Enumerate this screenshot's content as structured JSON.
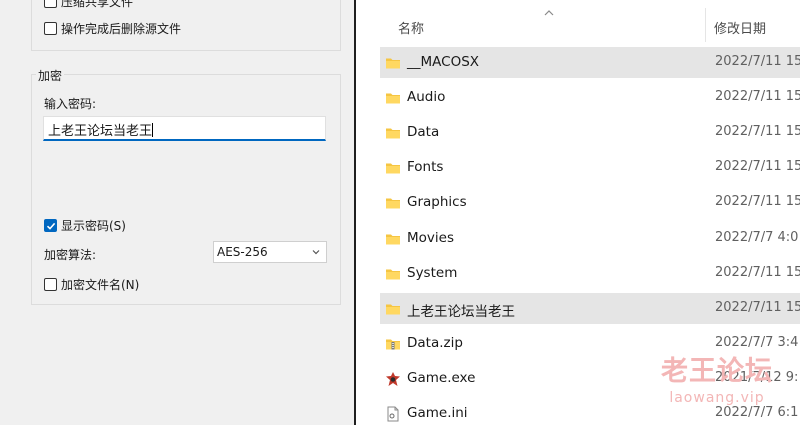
{
  "options": {
    "compress_shared_label": "压缩共享文件",
    "delete_source_label": "操作完成后删除源文件"
  },
  "encryption": {
    "group_title": "加密",
    "password_label": "输入密码:",
    "password_value": "上老王论坛当老王",
    "show_password_label": "显示密码(S)",
    "show_password_checked": true,
    "method_label": "加密算法:",
    "method_value": "AES-256",
    "encrypt_names_label": "加密文件名(N)",
    "encrypt_names_checked": false
  },
  "explorer": {
    "columns": {
      "name": "名称",
      "date": "修改日期"
    },
    "files": [
      {
        "name": "__MACOSX",
        "date": "2022/7/11 15",
        "icon": "folder-icon",
        "selected": true
      },
      {
        "name": "Audio",
        "date": "2022/7/11 15",
        "icon": "folder-icon",
        "selected": false
      },
      {
        "name": "Data",
        "date": "2022/7/11 15",
        "icon": "folder-icon",
        "selected": false
      },
      {
        "name": "Fonts",
        "date": "2022/7/11 15",
        "icon": "folder-icon",
        "selected": false
      },
      {
        "name": "Graphics",
        "date": "2022/7/11 15",
        "icon": "folder-icon",
        "selected": false
      },
      {
        "name": "Movies",
        "date": "2022/7/7 4:0",
        "icon": "folder-icon",
        "selected": false
      },
      {
        "name": "System",
        "date": "2022/7/11 15",
        "icon": "folder-icon",
        "selected": false
      },
      {
        "name": "上老王论坛当老王",
        "date": "2022/7/11 15",
        "icon": "folder-icon",
        "selected": true
      },
      {
        "name": "Data.zip",
        "date": "2022/7/7 3:4",
        "icon": "zip-folder-icon",
        "selected": false
      },
      {
        "name": "Game.exe",
        "date": "2021/7/12 9:",
        "icon": "game-exe-icon",
        "selected": false
      },
      {
        "name": "Game.ini",
        "date": "2022/7/7 6:1",
        "icon": "ini-file-icon",
        "selected": false
      }
    ]
  },
  "watermark": {
    "main": "老王论坛",
    "sub": "laowang.vip"
  },
  "colors": {
    "accent": "#0067c0",
    "folder": "#f5c542",
    "selection": "#e5e5e5"
  }
}
